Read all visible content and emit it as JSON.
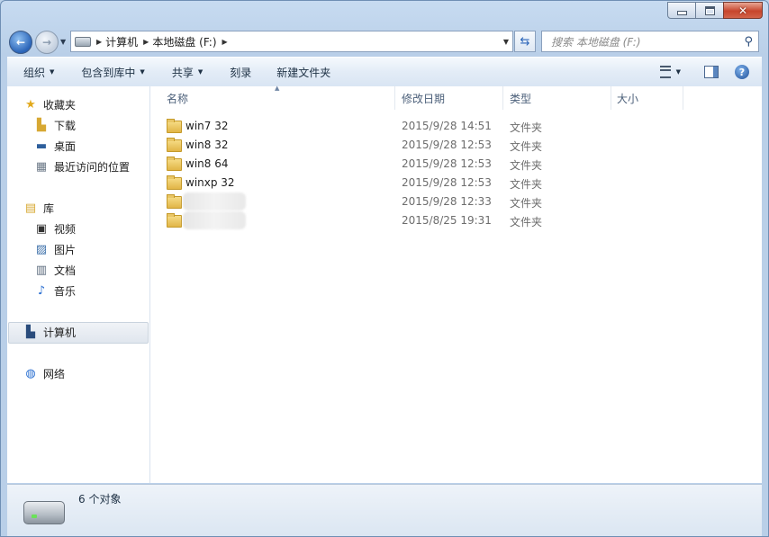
{
  "window": {
    "caption_buttons": [
      "minimize",
      "maximize",
      "close"
    ]
  },
  "address": {
    "segments": [
      "计算机",
      "本地磁盘 (F:)"
    ],
    "search_placeholder": "搜索 本地磁盘 (F:)"
  },
  "toolbar": {
    "organize": "组织",
    "include_in_library": "包含到库中",
    "share": "共享",
    "burn": "刻录",
    "new_folder": "新建文件夹"
  },
  "nav": {
    "favorites": "收藏夹",
    "downloads": "下载",
    "desktop": "桌面",
    "recent": "最近访问的位置",
    "libraries": "库",
    "videos": "视频",
    "pictures": "图片",
    "documents": "文档",
    "music": "音乐",
    "computer": "计算机",
    "network": "网络"
  },
  "columns": {
    "name": "名称",
    "date": "修改日期",
    "type": "类型",
    "size": "大小"
  },
  "files": [
    {
      "name": "win7 32",
      "date": "2015/9/28 14:51",
      "type": "文件夹"
    },
    {
      "name": "win8 32",
      "date": "2015/9/28 12:53",
      "type": "文件夹"
    },
    {
      "name": "win8 64",
      "date": "2015/9/28 12:53",
      "type": "文件夹"
    },
    {
      "name": "winxp 32",
      "date": "2015/9/28 12:53",
      "type": "文件夹"
    },
    {
      "name": "",
      "date": "2015/9/28 12:33",
      "type": "文件夹"
    },
    {
      "name": "",
      "date": "2015/8/25 19:31",
      "type": "文件夹"
    }
  ],
  "status": {
    "count": "6 个对象"
  },
  "icons": {
    "back": "back-arrow-icon",
    "forward": "forward-arrow-icon",
    "search": "magnifier-icon",
    "refresh": "refresh-icon",
    "help": "help-icon"
  },
  "colors": {
    "accent": "#2a64b8",
    "chrome": "#c7dbf1",
    "folder": "#e1b547"
  }
}
